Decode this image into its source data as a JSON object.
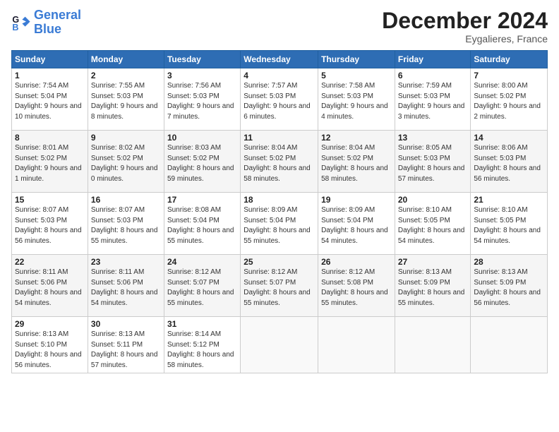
{
  "header": {
    "logo_line1": "General",
    "logo_line2": "Blue",
    "month": "December 2024",
    "location": "Eygalieres, France"
  },
  "weekdays": [
    "Sunday",
    "Monday",
    "Tuesday",
    "Wednesday",
    "Thursday",
    "Friday",
    "Saturday"
  ],
  "weeks": [
    [
      {
        "day": "1",
        "sunrise": "7:54 AM",
        "sunset": "5:04 PM",
        "daylight": "9 hours and 10 minutes."
      },
      {
        "day": "2",
        "sunrise": "7:55 AM",
        "sunset": "5:03 PM",
        "daylight": "9 hours and 8 minutes."
      },
      {
        "day": "3",
        "sunrise": "7:56 AM",
        "sunset": "5:03 PM",
        "daylight": "9 hours and 7 minutes."
      },
      {
        "day": "4",
        "sunrise": "7:57 AM",
        "sunset": "5:03 PM",
        "daylight": "9 hours and 6 minutes."
      },
      {
        "day": "5",
        "sunrise": "7:58 AM",
        "sunset": "5:03 PM",
        "daylight": "9 hours and 4 minutes."
      },
      {
        "day": "6",
        "sunrise": "7:59 AM",
        "sunset": "5:03 PM",
        "daylight": "9 hours and 3 minutes."
      },
      {
        "day": "7",
        "sunrise": "8:00 AM",
        "sunset": "5:02 PM",
        "daylight": "9 hours and 2 minutes."
      }
    ],
    [
      {
        "day": "8",
        "sunrise": "8:01 AM",
        "sunset": "5:02 PM",
        "daylight": "9 hours and 1 minute."
      },
      {
        "day": "9",
        "sunrise": "8:02 AM",
        "sunset": "5:02 PM",
        "daylight": "9 hours and 0 minutes."
      },
      {
        "day": "10",
        "sunrise": "8:03 AM",
        "sunset": "5:02 PM",
        "daylight": "8 hours and 59 minutes."
      },
      {
        "day": "11",
        "sunrise": "8:04 AM",
        "sunset": "5:02 PM",
        "daylight": "8 hours and 58 minutes."
      },
      {
        "day": "12",
        "sunrise": "8:04 AM",
        "sunset": "5:02 PM",
        "daylight": "8 hours and 58 minutes."
      },
      {
        "day": "13",
        "sunrise": "8:05 AM",
        "sunset": "5:03 PM",
        "daylight": "8 hours and 57 minutes."
      },
      {
        "day": "14",
        "sunrise": "8:06 AM",
        "sunset": "5:03 PM",
        "daylight": "8 hours and 56 minutes."
      }
    ],
    [
      {
        "day": "15",
        "sunrise": "8:07 AM",
        "sunset": "5:03 PM",
        "daylight": "8 hours and 56 minutes."
      },
      {
        "day": "16",
        "sunrise": "8:07 AM",
        "sunset": "5:03 PM",
        "daylight": "8 hours and 55 minutes."
      },
      {
        "day": "17",
        "sunrise": "8:08 AM",
        "sunset": "5:04 PM",
        "daylight": "8 hours and 55 minutes."
      },
      {
        "day": "18",
        "sunrise": "8:09 AM",
        "sunset": "5:04 PM",
        "daylight": "8 hours and 55 minutes."
      },
      {
        "day": "19",
        "sunrise": "8:09 AM",
        "sunset": "5:04 PM",
        "daylight": "8 hours and 54 minutes."
      },
      {
        "day": "20",
        "sunrise": "8:10 AM",
        "sunset": "5:05 PM",
        "daylight": "8 hours and 54 minutes."
      },
      {
        "day": "21",
        "sunrise": "8:10 AM",
        "sunset": "5:05 PM",
        "daylight": "8 hours and 54 minutes."
      }
    ],
    [
      {
        "day": "22",
        "sunrise": "8:11 AM",
        "sunset": "5:06 PM",
        "daylight": "8 hours and 54 minutes."
      },
      {
        "day": "23",
        "sunrise": "8:11 AM",
        "sunset": "5:06 PM",
        "daylight": "8 hours and 54 minutes."
      },
      {
        "day": "24",
        "sunrise": "8:12 AM",
        "sunset": "5:07 PM",
        "daylight": "8 hours and 55 minutes."
      },
      {
        "day": "25",
        "sunrise": "8:12 AM",
        "sunset": "5:07 PM",
        "daylight": "8 hours and 55 minutes."
      },
      {
        "day": "26",
        "sunrise": "8:12 AM",
        "sunset": "5:08 PM",
        "daylight": "8 hours and 55 minutes."
      },
      {
        "day": "27",
        "sunrise": "8:13 AM",
        "sunset": "5:09 PM",
        "daylight": "8 hours and 55 minutes."
      },
      {
        "day": "28",
        "sunrise": "8:13 AM",
        "sunset": "5:09 PM",
        "daylight": "8 hours and 56 minutes."
      }
    ],
    [
      {
        "day": "29",
        "sunrise": "8:13 AM",
        "sunset": "5:10 PM",
        "daylight": "8 hours and 56 minutes."
      },
      {
        "day": "30",
        "sunrise": "8:13 AM",
        "sunset": "5:11 PM",
        "daylight": "8 hours and 57 minutes."
      },
      {
        "day": "31",
        "sunrise": "8:14 AM",
        "sunset": "5:12 PM",
        "daylight": "8 hours and 58 minutes."
      },
      null,
      null,
      null,
      null
    ]
  ]
}
